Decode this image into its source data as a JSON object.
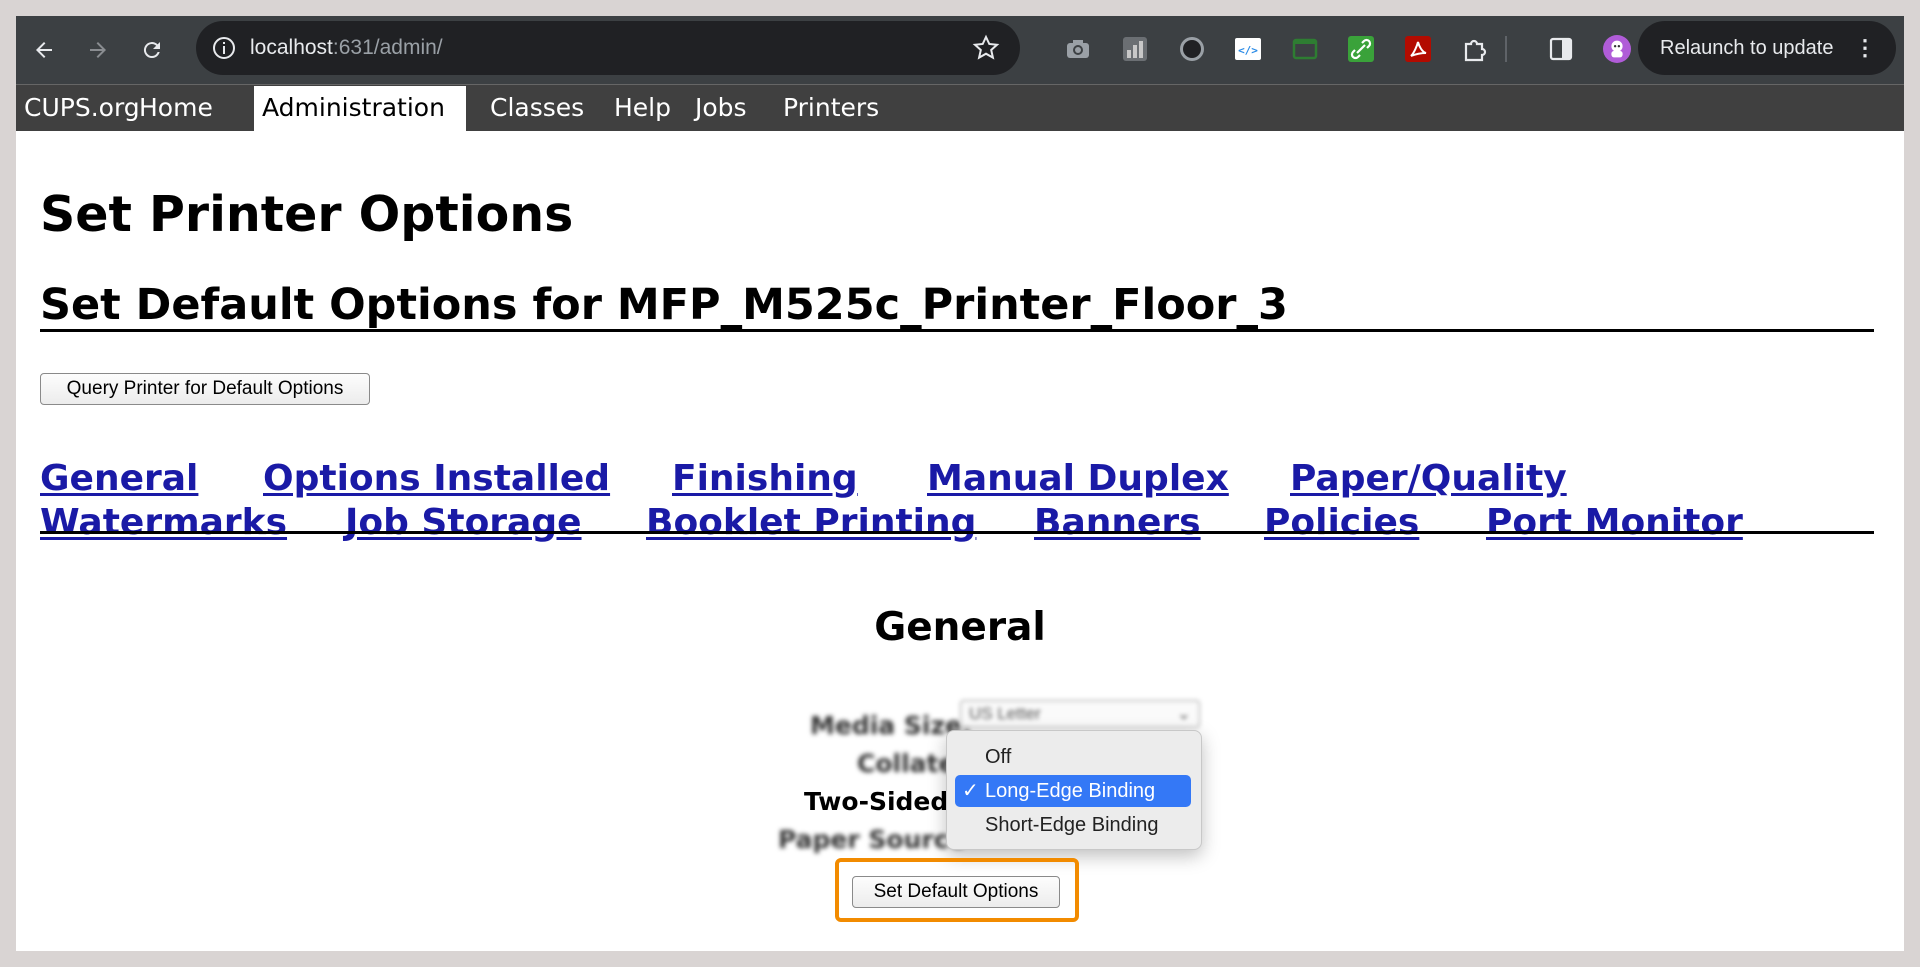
{
  "browser": {
    "url_host": "localhost",
    "url_rest": ":631/admin/",
    "relaunch_label": "Relaunch to update",
    "relaunch_dots": "⋮",
    "extensions": [
      "camera-icon",
      "chart-icon",
      "circle-icon",
      "code-icon",
      "window-icon",
      "link-icon",
      "pdf-icon",
      "puzzle-icon",
      "sidepanel-icon",
      "profile-avatar"
    ]
  },
  "cups_nav": {
    "items": [
      "CUPS.org",
      "Home",
      "Administration",
      "Classes",
      "Help",
      "Jobs",
      "Printers"
    ],
    "active": "Administration"
  },
  "page": {
    "title": "Set Printer Options",
    "section_title": "Set Default Options for MFP_M525c_Printer_Floor_3",
    "query_button": "Query Printer for Default Options",
    "tabs_row1": [
      "General",
      "Options Installed",
      "Finishing",
      "Manual Duplex",
      "Paper/Quality"
    ],
    "tabs_row2": [
      "Watermarks",
      "Job Storage",
      "Booklet Printing",
      "Banners",
      "Policies",
      "Port Monitor"
    ],
    "general_heading": "General",
    "options": {
      "media_size_label": "Media Size:",
      "media_size_value": "US Letter",
      "collate_label": "Collate",
      "two_sided_label": "Two-Sided",
      "paper_source_label": "Paper Source"
    },
    "dropdown": {
      "items": [
        "Off",
        "Long-Edge Binding",
        "Short-Edge Binding"
      ],
      "selected": "Long-Edge Binding",
      "check": "✓"
    },
    "submit_button": "Set Default Options"
  },
  "colors": {
    "link": "#1a1aa6",
    "chrome_toolbar": "#3c4043",
    "cups_nav": "#404040",
    "dropdown_selection": "#3478f6",
    "highlight": "#f28b00"
  }
}
